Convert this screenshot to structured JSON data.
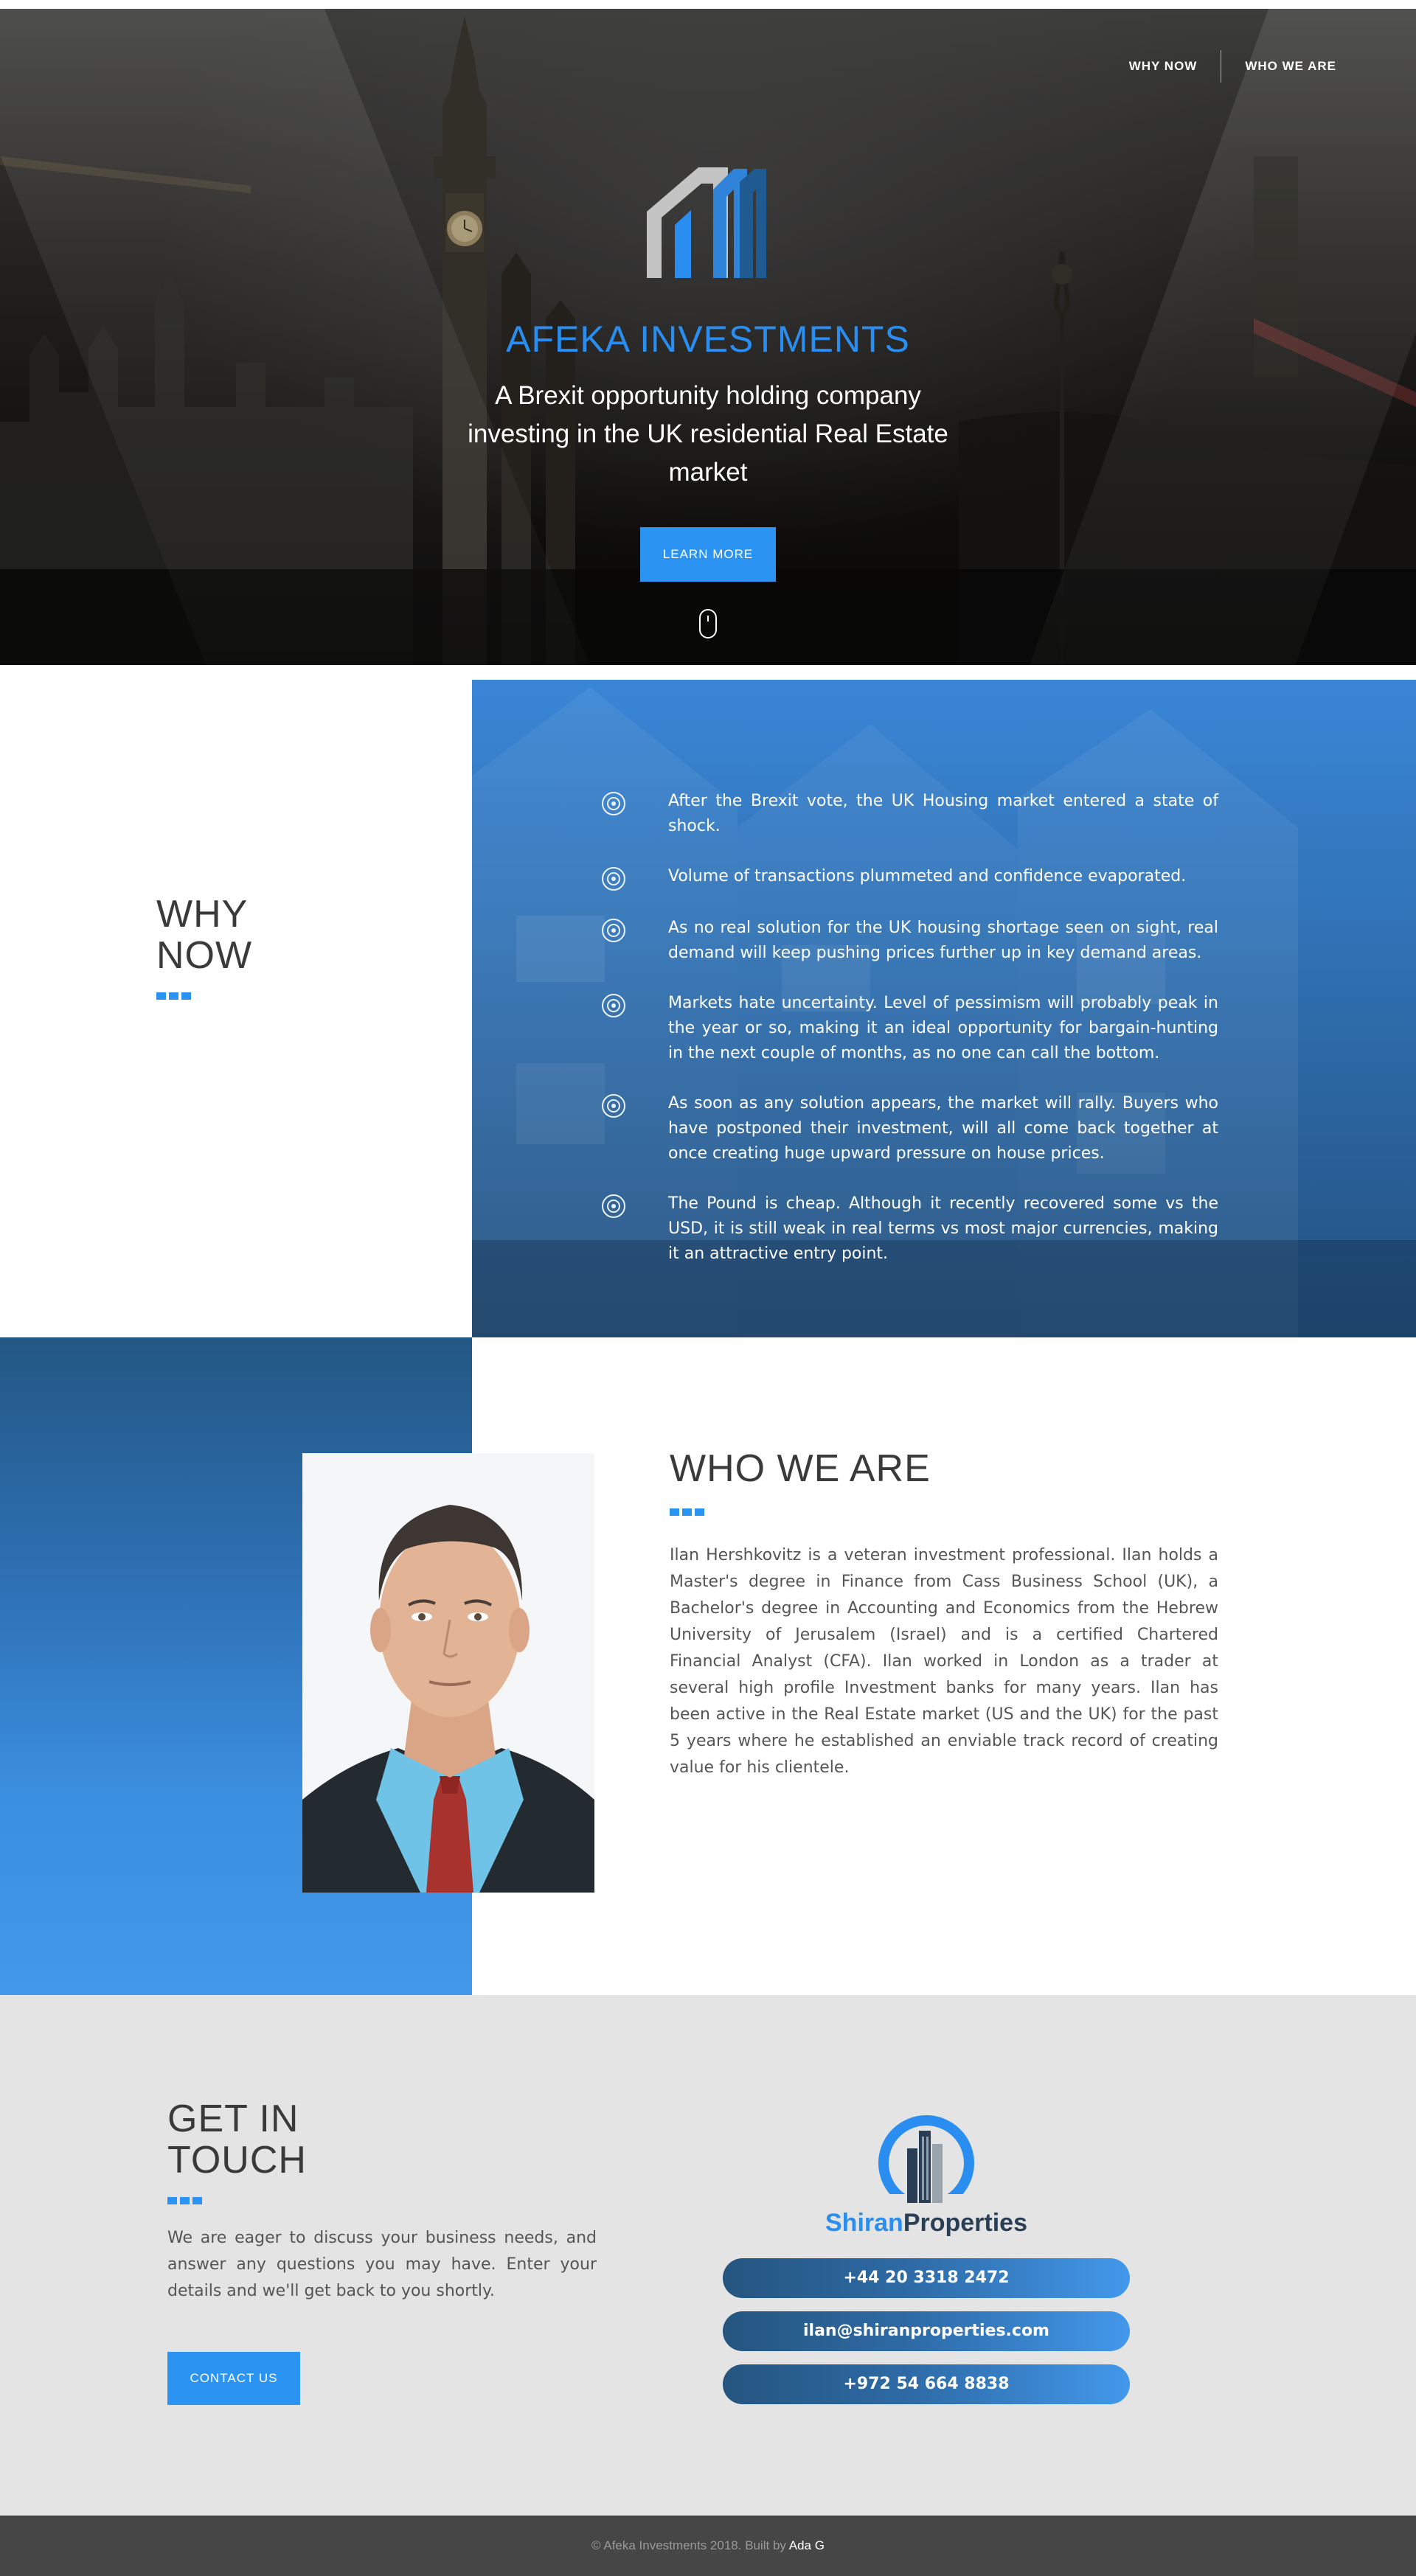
{
  "nav": {
    "items": [
      {
        "label": "WHY NOW"
      },
      {
        "label": "WHO WE ARE"
      }
    ]
  },
  "hero": {
    "title": "AFEKA INVESTMENTS",
    "subtitle": "A Brexit opportunity holding company investing in the UK residential Real Estate market",
    "cta_label": "LEARN MORE"
  },
  "why": {
    "title_line1": "WHY",
    "title_line2": "NOW",
    "items": [
      "After the Brexit vote, the UK Housing market entered a state of shock.",
      "Volume of transactions plummeted and confidence evaporated.",
      "As no real solution for the UK housing shortage seen on sight, real demand will keep pushing prices further up in key demand areas.",
      "Markets hate uncertainty. Level of pessimism will probably peak in the year or so, making it an ideal opportunity for bargain-hunting in the next couple of months, as no one can call the bottom.",
      "As soon as any solution appears, the market will rally. Buyers who have postponed their investment, will all come back together at once creating huge upward pressure on house prices.",
      "The Pound is cheap. Although it recently recovered some vs the USD, it is still weak in real terms vs most major currencies, making it an attractive entry point."
    ]
  },
  "who": {
    "title": "WHO WE ARE",
    "body": "Ilan Hershkovitz is a veteran investment professional. Ilan holds a Master's degree in Finance from Cass Business School (UK), a Bachelor's degree in Accounting and Economics from the Hebrew University of Jerusalem (Israel) and is a certified Chartered Financial Analyst (CFA). Ilan worked in London as a trader at several high profile Investment banks for many years. Ilan has been active in the Real Estate market (US and the UK) for the past 5 years where he established an enviable track record of creating value for his clientele."
  },
  "touch": {
    "title_line1": "GET IN",
    "title_line2": "TOUCH",
    "body": "We are eager to discuss your business needs, and answer any questions you may have. Enter your details and we'll get back to you shortly.",
    "cta_label": "CONTACT US",
    "brand_part1": "Shiran",
    "brand_part2": "Properties",
    "phone_uk": "+44 20 3318 2472",
    "email": "ilan@shiranproperties.com",
    "phone_il": "+972 54 664 8838"
  },
  "footer": {
    "text": "© Afeka Investments 2018. Built by",
    "author": "Ada G"
  },
  "colors": {
    "accent": "#2b93f1",
    "title_blue": "#2a8df0",
    "dark_text": "#3a3a3a",
    "footer_bg": "#464646",
    "touch_bg": "#e4e4e4"
  },
  "icons": [
    "mouse-scroll-icon",
    "target-icon",
    "afeka-logo",
    "shiran-logo"
  ]
}
